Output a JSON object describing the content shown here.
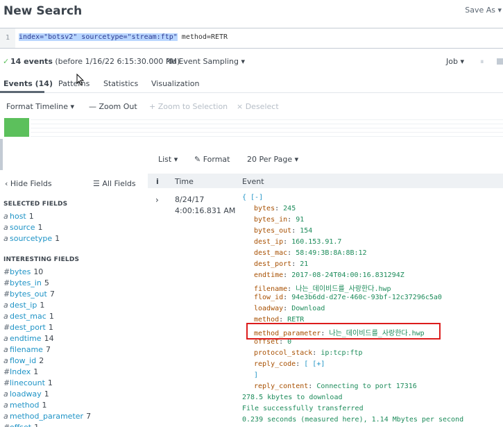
{
  "header": {
    "title": "New Search",
    "save_as": "Save As ▾"
  },
  "search": {
    "line_number": "1",
    "query_selected": "index=\"botsv2\" sourcetype=\"stream:ftp\"",
    "query_rest": " method=RETR"
  },
  "status": {
    "check": "✓",
    "event_count": "14 events",
    "before": "(before 1/16/22 6:15:30.000 PM)",
    "sampling": "No Event Sampling ▾",
    "job": "Job ▾",
    "pause": "⏸"
  },
  "tabs": [
    {
      "label": "Events (14)"
    },
    {
      "label": "Patterns"
    },
    {
      "label": "Statistics"
    },
    {
      "label": "Visualization"
    }
  ],
  "timeline": {
    "format": "Format Timeline ▾",
    "zoom_out": "— Zoom Out",
    "zoom_selection": "+ Zoom to Selection",
    "deselect": "× Deselect"
  },
  "pagebar": {
    "list": "List ▾",
    "format": "✎ Format",
    "per_page": "20 Per Page ▾"
  },
  "sidebar": {
    "hide_fields": "‹ Hide Fields",
    "all_fields": "☰ All Fields",
    "selected_title": "SELECTED FIELDS",
    "interesting_title": "INTERESTING FIELDS",
    "selected": [
      {
        "type": "a",
        "name": "host",
        "count": "1"
      },
      {
        "type": "a",
        "name": "source",
        "count": "1"
      },
      {
        "type": "a",
        "name": "sourcetype",
        "count": "1"
      }
    ],
    "interesting": [
      {
        "type": "#",
        "name": "bytes",
        "count": "10"
      },
      {
        "type": "#",
        "name": "bytes_in",
        "count": "5"
      },
      {
        "type": "#",
        "name": "bytes_out",
        "count": "7"
      },
      {
        "type": "a",
        "name": "dest_ip",
        "count": "1"
      },
      {
        "type": "a",
        "name": "dest_mac",
        "count": "1"
      },
      {
        "type": "#",
        "name": "dest_port",
        "count": "1"
      },
      {
        "type": "a",
        "name": "endtime",
        "count": "14"
      },
      {
        "type": "a",
        "name": "filename",
        "count": "7"
      },
      {
        "type": "a",
        "name": "flow_id",
        "count": "2"
      },
      {
        "type": "#",
        "name": "Index",
        "count": "1"
      },
      {
        "type": "#",
        "name": "linecount",
        "count": "1"
      },
      {
        "type": "a",
        "name": "loadway",
        "count": "1"
      },
      {
        "type": "a",
        "name": "method",
        "count": "1"
      },
      {
        "type": "a",
        "name": "method_parameter",
        "count": "7"
      },
      {
        "type": "#",
        "name": "offset",
        "count": "1"
      }
    ]
  },
  "events_table": {
    "col_info": "i",
    "col_time": "Time",
    "col_event": "Event",
    "expand": "›",
    "date": "8/24/17",
    "time": "4:00:16.831 AM",
    "open_brace": "{ [-]",
    "fields": [
      {
        "key": "bytes",
        "value": "245"
      },
      {
        "key": "bytes_in",
        "value": "91"
      },
      {
        "key": "bytes_out",
        "value": "154"
      },
      {
        "key": "dest_ip",
        "value": "160.153.91.7"
      },
      {
        "key": "dest_mac",
        "value": "58:49:3B:8A:8B:12"
      },
      {
        "key": "dest_port",
        "value": "21"
      },
      {
        "key": "endtime",
        "value": "2017-08-24T04:00:16.831294Z"
      },
      {
        "key": "filename",
        "value": "나는_데이비드를_사랑한다.hwp"
      },
      {
        "key": "flow_id",
        "value": "94e3b6dd-d27e-460c-93bf-12c37296c5a0"
      },
      {
        "key": "loadway",
        "value": "Download"
      },
      {
        "key": "method",
        "value": "RETR"
      },
      {
        "key": "method_parameter",
        "value": "나는_데이비드를_사랑한다.hwp"
      },
      {
        "key": "offset",
        "value": "0"
      },
      {
        "key": "protocol_stack",
        "value": "ip:tcp:ftp"
      },
      {
        "key": "reply_code",
        "value": "[ [+]"
      }
    ],
    "close_bracket": "]",
    "reply_content_key": "reply_content",
    "reply_content_value": "Connecting to port 17316",
    "raw_lines": [
      "278.5 kbytes to download",
      "File successfully transferred",
      "0.239 seconds (measured here), 1.14 Mbytes per second"
    ]
  },
  "colors": {
    "accent_green": "#5cc05c",
    "link_blue": "#1e93c6",
    "key_orange": "#a74f00",
    "value_green": "#1c8b5a",
    "highlight_red": "#dc1c1c"
  }
}
